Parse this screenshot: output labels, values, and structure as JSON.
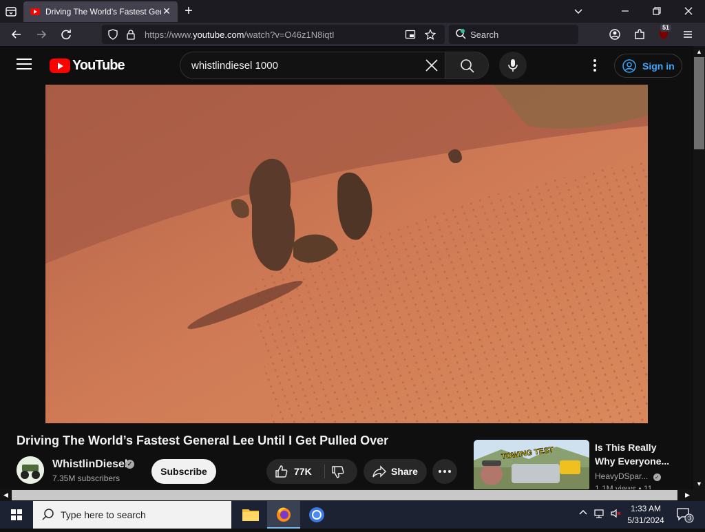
{
  "browser": {
    "tab_title": "Driving The World’s Fastest Genera",
    "url_prefix": "https://www.",
    "url_domain": "youtube.com",
    "url_path": "/watch?v=O46z1N8iqtI",
    "search_placeholder": "Search",
    "extension_badge": "51"
  },
  "youtube": {
    "logo_text": "YouTube",
    "search_query": "whistlindiesel 1000",
    "sign_in_label": "Sign in"
  },
  "video": {
    "title": "Driving The World’s Fastest General Lee Until I Get Pulled Over",
    "channel_name": "WhistlinDiesel",
    "subscribers": "7.35M subscribers",
    "subscribe_label": "Subscribe",
    "likes": "77K",
    "share_label": "Share"
  },
  "recommendation": {
    "title": "Is This Really Why Everyone...",
    "channel": "HeavyDSpar...",
    "views": "1.1M views • 11",
    "thumb_text": "TOWING TEST"
  },
  "taskbar": {
    "search_placeholder": "Type here to search",
    "time": "1:33 AM",
    "date": "5/31/2024",
    "notifications": "3"
  }
}
